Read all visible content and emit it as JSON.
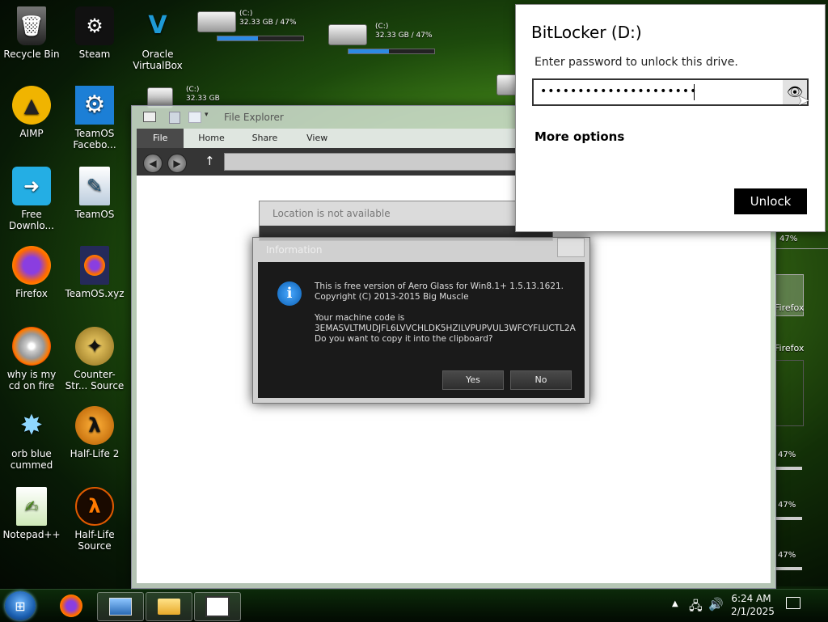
{
  "desktop_icons": [
    {
      "label": "Recycle Bin",
      "icon": "recycle-bin-icon"
    },
    {
      "label": "Steam",
      "icon": "steam-icon"
    },
    {
      "label": "Oracle VirtualBox",
      "icon": "virtualbox-icon"
    },
    {
      "label": "AIMP",
      "icon": "aimp-icon"
    },
    {
      "label": "TeamOS Facebo...",
      "icon": "gear-icon"
    },
    {
      "label": "Free Downlo...",
      "icon": "download-icon"
    },
    {
      "label": "TeamOS",
      "icon": "teamos-icon"
    },
    {
      "label": "Firefox",
      "icon": "firefox-icon"
    },
    {
      "label": "TeamOS.xyz",
      "icon": "firefox-file-icon"
    },
    {
      "label": "why is my cd on fire",
      "icon": "cd-fire-icon"
    },
    {
      "label": "Counter-Str... Source",
      "icon": "counter-strike-icon"
    },
    {
      "label": "orb blue cummed",
      "icon": "orb-icon"
    },
    {
      "label": "Half-Life 2",
      "icon": "half-life-2-icon"
    },
    {
      "label": "Notepad++",
      "icon": "notepad-plus-icon"
    },
    {
      "label": "Half-Life Source",
      "icon": "half-life-icon"
    }
  ],
  "drives": [
    {
      "name": "(C:)",
      "usage": "32.33 GB / 47%",
      "percent": 47
    },
    {
      "name": "(C:)",
      "usage": "32.33 GB / 47%",
      "percent": 47
    },
    {
      "name": "(C:)",
      "usage": "32.33 GB",
      "percent": 47
    }
  ],
  "file_explorer": {
    "title": "File Explorer",
    "tabs": [
      "File",
      "Home",
      "Share",
      "View"
    ]
  },
  "location_dialog": {
    "title": "Location is not available"
  },
  "info_dialog": {
    "title": "Information",
    "line1": "This is free version of Aero Glass for Win8.1+ 1.5.13.1621.",
    "line2": "Copyright (C) 2013-2015 Big Muscle",
    "line3": "Your machine code is",
    "code": "3EMASVLTMUDJFL6LVVCHLDK5HZILVPUPVUL3WFCYFLUCTL2A",
    "question": "Do you want to copy it into the clipboard?",
    "yes": "Yes",
    "no": "No"
  },
  "bitlocker": {
    "title": "BitLocker (D:)",
    "prompt": "Enter password to unlock this drive.",
    "password_mask": "•••••••••••••••••••••",
    "more_options": "More options",
    "unlock": "Unlock"
  },
  "right_strip": {
    "pct1": "47%",
    "firefox1": "Firefox",
    "firefox2": "Firefox",
    "pct2": "47%",
    "pct3": "47%",
    "pct4": "47%"
  },
  "taskbar": {
    "time": "6:24 AM",
    "date": "2/1/2025"
  }
}
